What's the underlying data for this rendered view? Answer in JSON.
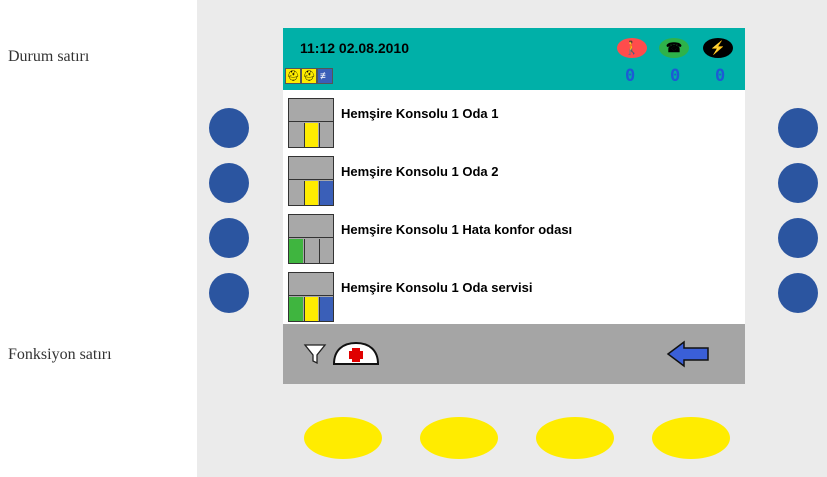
{
  "labels": {
    "status_row": "Durum satırı",
    "function_row": "Fonksiyon satırı"
  },
  "status": {
    "datetime": "11:12 02.08.2010",
    "counts": [
      "0",
      "0",
      "0"
    ],
    "icons": [
      "person-alert-icon",
      "handset-icon",
      "lightning-icon"
    ],
    "icon_colors": [
      "#ff4c4c",
      "#2eb24a",
      "#000000"
    ]
  },
  "rooms": [
    {
      "label": "Hemşire Konsolu  1  Oda 1",
      "cells": [
        "#a8a8a8",
        "#ffec00",
        "#a8a8a8"
      ]
    },
    {
      "label": "Hemşire Konsolu  1  Oda 2",
      "cells": [
        "#a8a8a8",
        "#ffec00",
        "#3a5fb8"
      ]
    },
    {
      "label": "Hemşire Konsolu  1  Hata konfor odası",
      "cells": [
        "#3fb53f",
        "#a8a8a8",
        "#a8a8a8"
      ]
    },
    {
      "label": "Hemşire Konsolu  1  Oda servisi",
      "cells": [
        "#3fb53f",
        "#ffec00",
        "#3a5fb8"
      ]
    }
  ],
  "function_bar": {
    "icons": [
      "filter-icon",
      "nurse-cap-icon",
      "back-arrow-icon"
    ]
  },
  "colors": {
    "status_bg": "#00b0a8",
    "side_button": "#2b55a0",
    "footer_button": "#ffec00",
    "counter": "#1d5ad4"
  }
}
